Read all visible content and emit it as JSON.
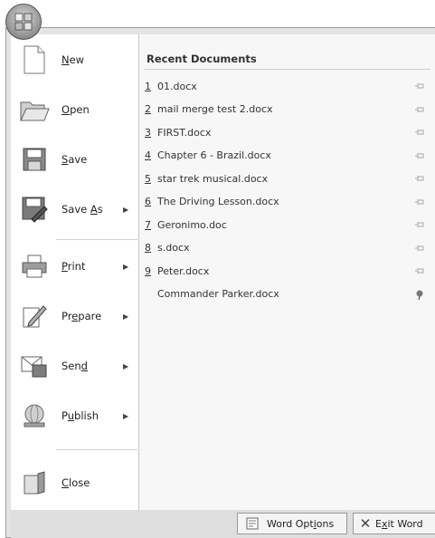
{
  "office_button": {
    "icon": "office-logo-icon"
  },
  "commands": [
    {
      "pre": "",
      "accel": "N",
      "post": "ew",
      "icon": "new-document-icon",
      "submenu": false
    },
    {
      "pre": "",
      "accel": "O",
      "post": "pen",
      "icon": "open-folder-icon",
      "submenu": false
    },
    {
      "pre": "",
      "accel": "S",
      "post": "ave",
      "icon": "save-disk-icon",
      "submenu": false
    },
    {
      "pre": "Save ",
      "accel": "A",
      "post": "s",
      "icon": "save-as-icon",
      "submenu": true
    },
    {
      "pre": "",
      "accel": "P",
      "post": "rint",
      "icon": "printer-icon",
      "submenu": true
    },
    {
      "pre": "Pr",
      "accel": "e",
      "post": "pare",
      "icon": "prepare-pencil-icon",
      "submenu": true
    },
    {
      "pre": "Sen",
      "accel": "d",
      "post": "",
      "icon": "send-mail-icon",
      "submenu": true
    },
    {
      "pre": "P",
      "accel": "u",
      "post": "blish",
      "icon": "publish-globe-icon",
      "submenu": true
    },
    {
      "pre": "",
      "accel": "C",
      "post": "lose",
      "icon": "close-document-icon",
      "submenu": false
    }
  ],
  "recent": {
    "title": "Recent Documents",
    "items": [
      {
        "num": "1",
        "name": "01.docx",
        "pinned": false
      },
      {
        "num": "2",
        "name": "mail merge test 2.docx",
        "pinned": false
      },
      {
        "num": "3",
        "name": "FIRST.docx",
        "pinned": false
      },
      {
        "num": "4",
        "name": "Chapter 6 - Brazil.docx",
        "pinned": false
      },
      {
        "num": "5",
        "name": "star trek musical.docx",
        "pinned": false
      },
      {
        "num": "6",
        "name": "The Driving Lesson.docx",
        "pinned": false
      },
      {
        "num": "7",
        "name": "Geronimo.doc",
        "pinned": false
      },
      {
        "num": "8",
        "name": "s.docx",
        "pinned": false
      },
      {
        "num": "9",
        "name": "Peter.docx",
        "pinned": false
      },
      {
        "num": "",
        "name": "Commander Parker.docx",
        "pinned": true
      }
    ]
  },
  "footer": {
    "options": {
      "pre": "Word Opt",
      "accel": "i",
      "post": "ons",
      "icon": "word-options-icon"
    },
    "exit": {
      "pre": "E",
      "accel": "x",
      "post": "it Word",
      "icon": "exit-x-icon"
    }
  }
}
